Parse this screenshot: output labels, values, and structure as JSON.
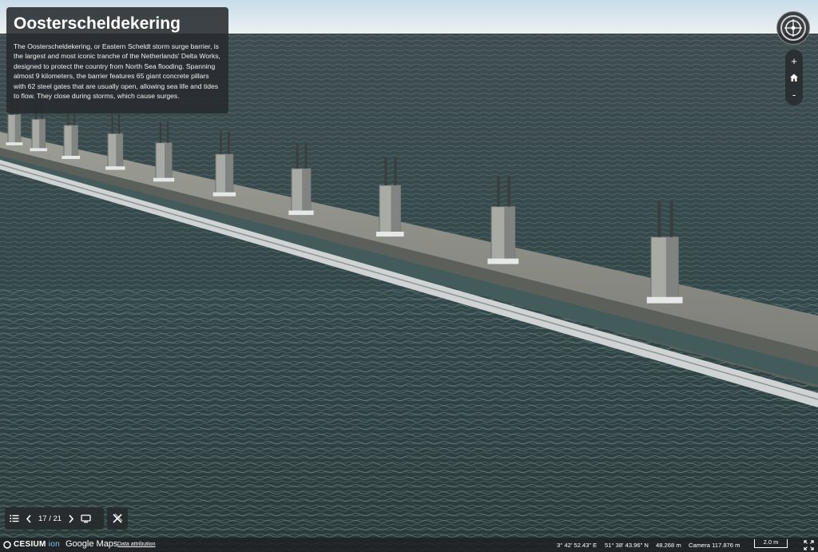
{
  "info": {
    "title": "Oosterscheldekering",
    "description": "The Oosterscheldekering, or Eastern Scheldt storm surge barrier, is the largest and most iconic tranche of the Netherlands' Delta Works, designed to protect the country from North Sea flooding. Spanning almost 9 kilometers, the barrier features 65 giant concrete pillars with 62 steel gates that are usually open, allowing sea life and tides to flow. They close during storms, which cause surges."
  },
  "tour": {
    "counter": "17 / 21"
  },
  "status": {
    "logo_primary": "CESIUM",
    "logo_secondary": "ion",
    "logo_google": "Google Maps",
    "attribution": "Data attribution",
    "longitude": "3° 42' 52.43\" E",
    "latitude": "51° 38' 43.96\" N",
    "elevation": "48.268 m",
    "camera": "Camera 117.876 m",
    "scale": "2.0 m"
  },
  "controls": {
    "zoom_in": "+",
    "zoom_out": "-"
  },
  "colors": {
    "panel": "#262a2e",
    "water": "#3c4d4e",
    "sky": "#dbe7ef",
    "ion_accent": "#7fc4ef"
  },
  "icons": [
    "compass-icon",
    "home-icon",
    "list-icon",
    "chevron-left-icon",
    "chevron-right-icon",
    "screen-icon",
    "close-icon",
    "fullscreen-icon"
  ]
}
